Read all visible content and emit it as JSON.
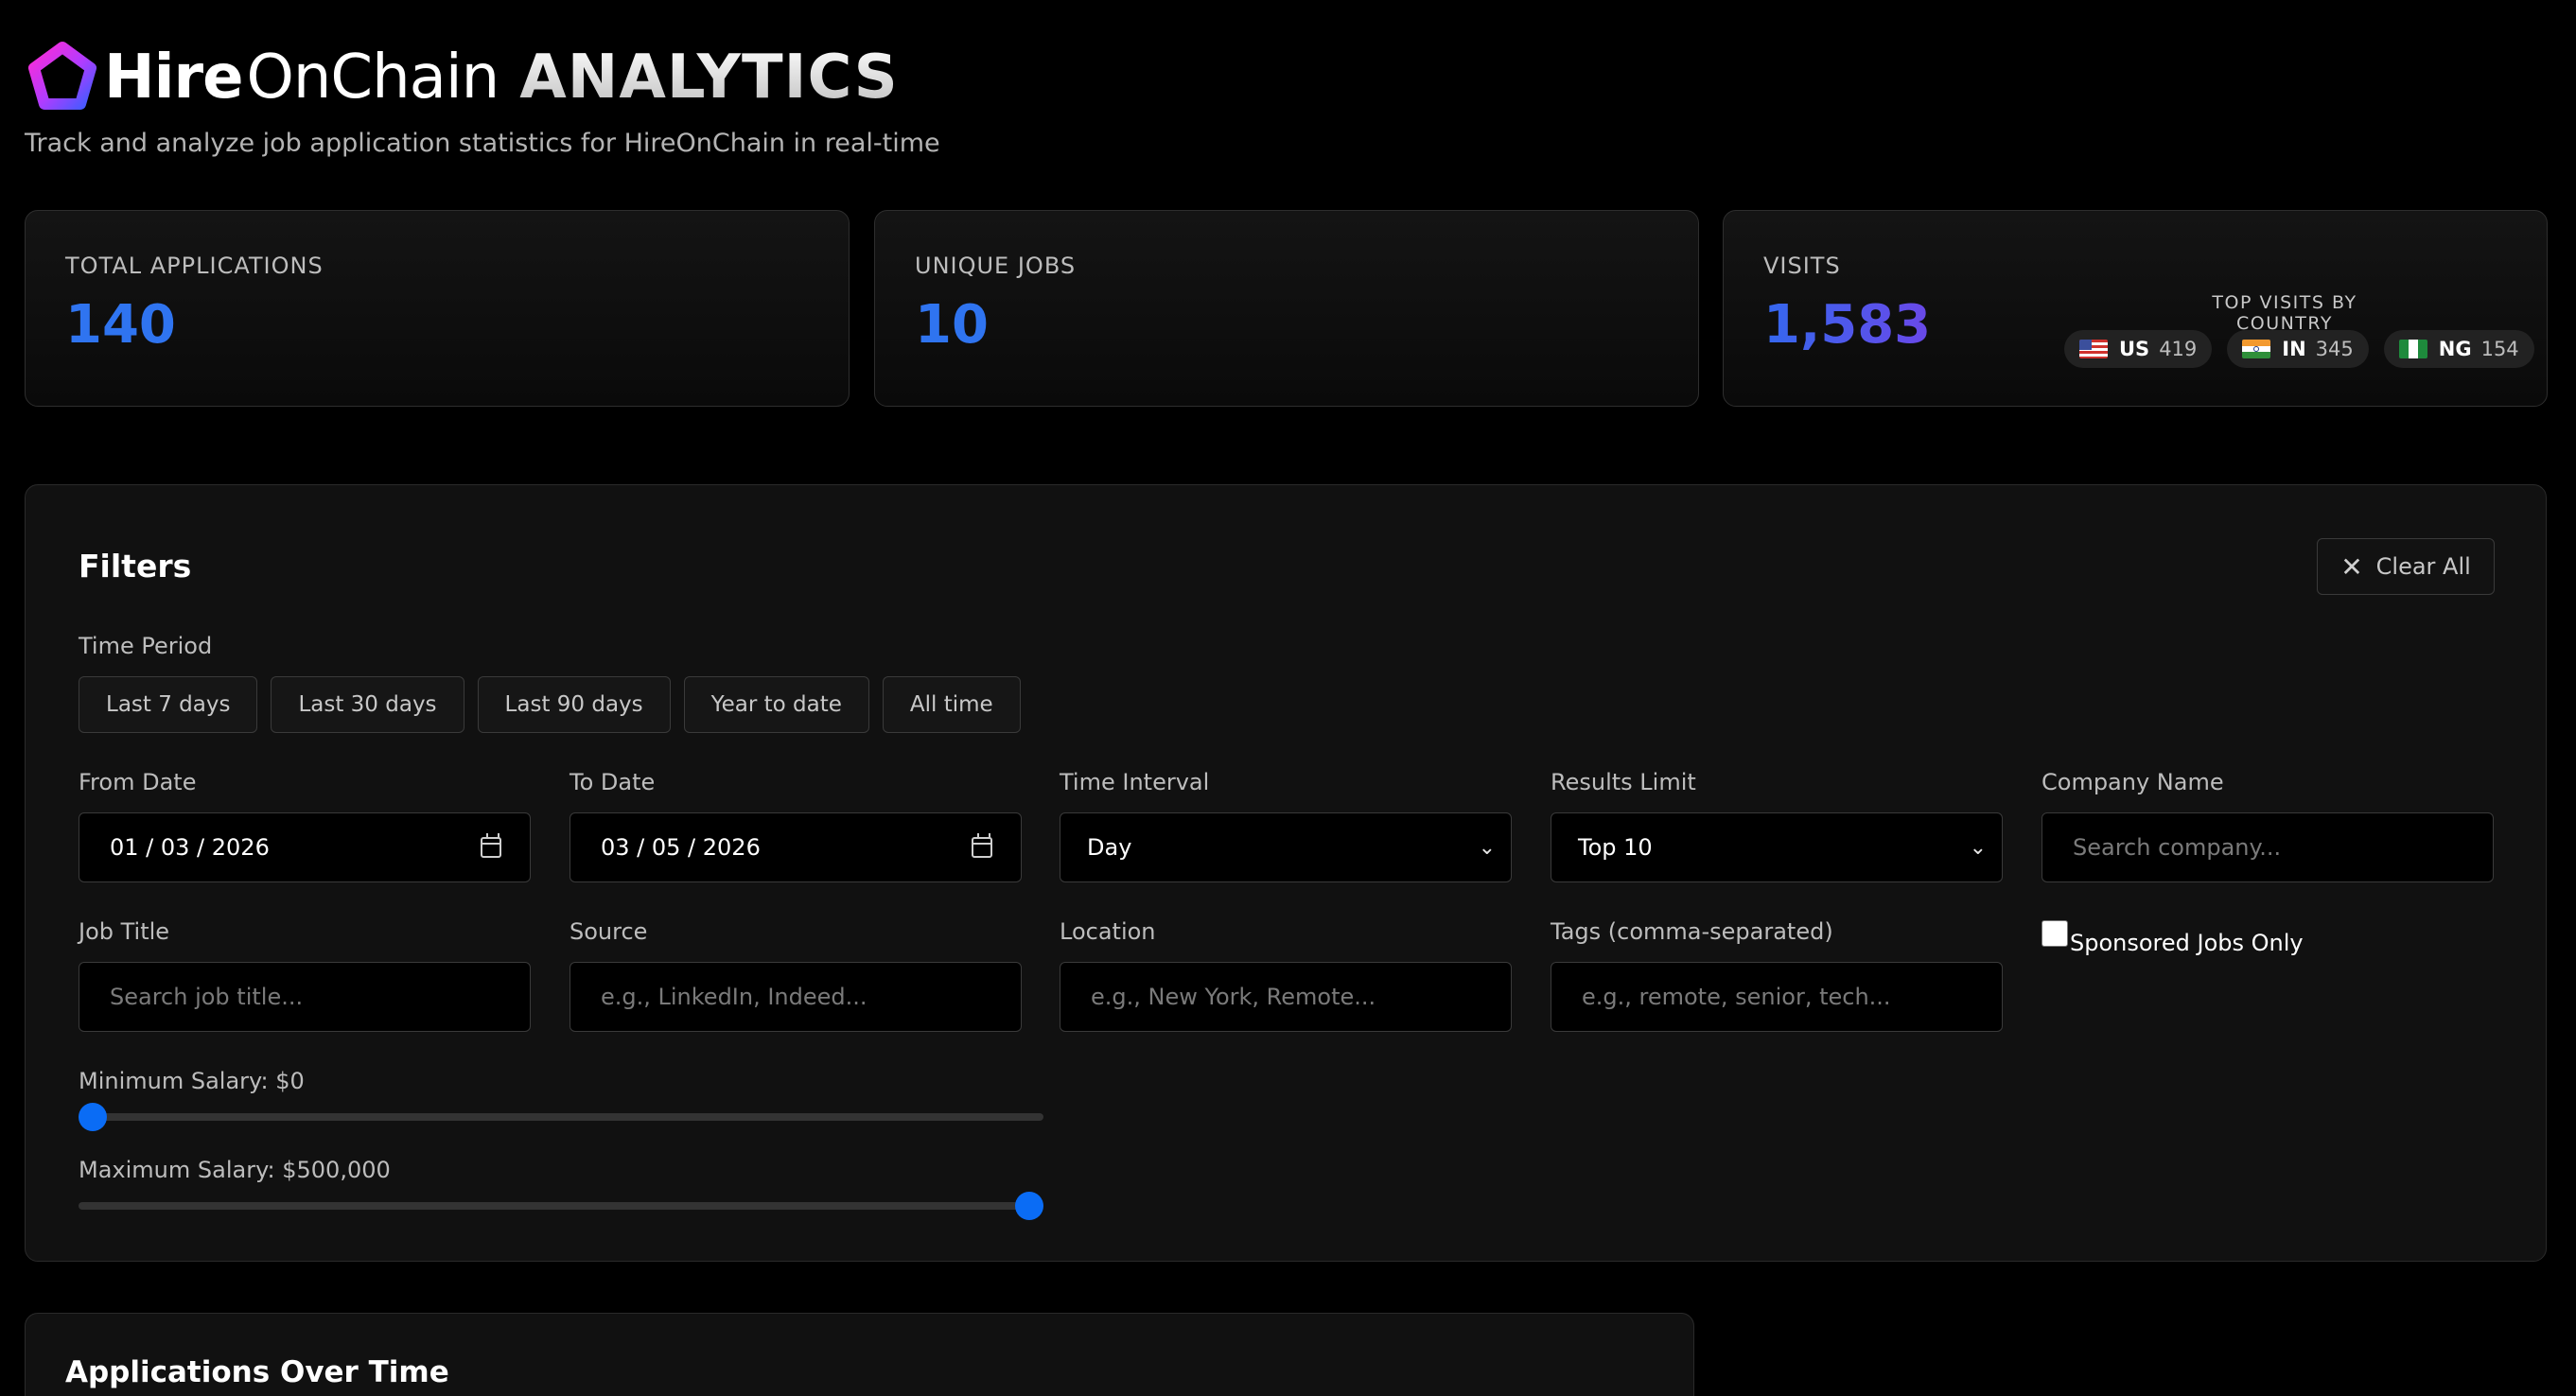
{
  "header": {
    "brand_hire": "Hire",
    "brand_onchain": "OnChain",
    "brand_analytics": "ANALYTICS",
    "subtitle": "Track and analyze job application statistics for HireOnChain in real-time"
  },
  "stats": {
    "total_applications": {
      "label": "TOTAL APPLICATIONS",
      "value": "140"
    },
    "unique_jobs": {
      "label": "UNIQUE JOBS",
      "value": "10"
    },
    "visits": {
      "label": "VISITS",
      "value": "1,583",
      "countries_title": "TOP VISITS BY COUNTRY",
      "countries": [
        {
          "code": "US",
          "count": "419"
        },
        {
          "code": "IN",
          "count": "345"
        },
        {
          "code": "NG",
          "count": "154"
        }
      ]
    }
  },
  "filters": {
    "title": "Filters",
    "clear_all": "Clear All",
    "time_period_label": "Time Period",
    "periods": [
      "Last 7 days",
      "Last 30 days",
      "Last 90 days",
      "Year to date",
      "All time"
    ],
    "from_date": {
      "label": "From Date",
      "value": "01 / 03 / 2026"
    },
    "to_date": {
      "label": "To Date",
      "value": "03 / 05 / 2026"
    },
    "time_interval": {
      "label": "Time Interval",
      "value": "Day"
    },
    "results_limit": {
      "label": "Results Limit",
      "value": "Top 10"
    },
    "company_name": {
      "label": "Company Name",
      "placeholder": "Search company..."
    },
    "job_title": {
      "label": "Job Title",
      "placeholder": "Search job title..."
    },
    "source": {
      "label": "Source",
      "placeholder": "e.g., LinkedIn, Indeed..."
    },
    "location": {
      "label": "Location",
      "placeholder": "e.g., New York, Remote..."
    },
    "tags": {
      "label": "Tags (comma-separated)",
      "placeholder": "e.g., remote, senior, tech..."
    },
    "sponsored_label": "Sponsored Jobs Only",
    "sponsored_checked": false,
    "min_salary": {
      "label": "Minimum Salary: $0",
      "fraction": 0
    },
    "max_salary": {
      "label": "Maximum Salary: $500,000",
      "fraction": 1
    }
  },
  "charts": {
    "applications_over_time_title": "Applications Over Time"
  },
  "colors": {
    "accent_blue": "#2f74f0",
    "slider_thumb": "#0a6cf5",
    "background": "#000000",
    "panel": "#111111"
  }
}
